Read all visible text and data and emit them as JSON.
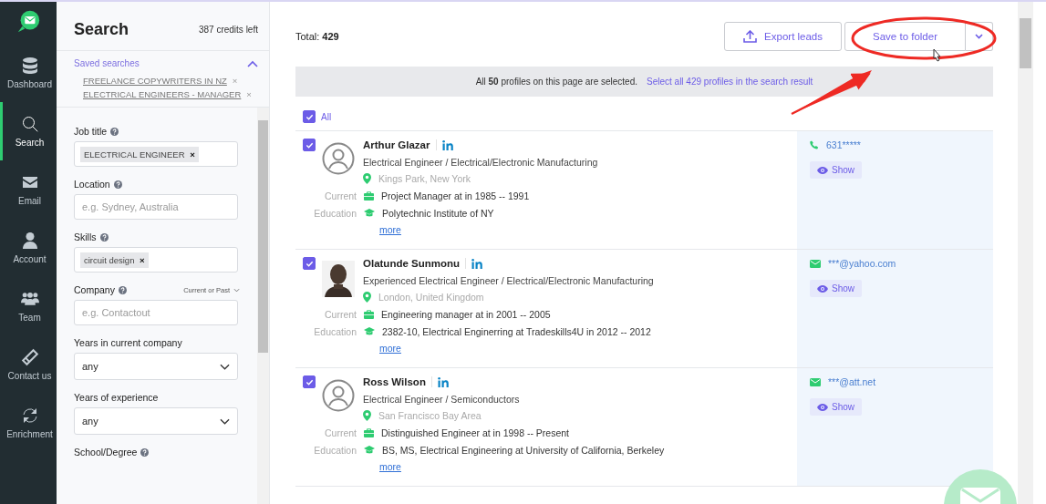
{
  "nav": {
    "items": [
      {
        "label": "Dashboard",
        "selected": false
      },
      {
        "label": "Search",
        "selected": true
      },
      {
        "label": "Email",
        "selected": false
      },
      {
        "label": "Account",
        "selected": false
      },
      {
        "label": "Team",
        "selected": false
      },
      {
        "label": "Contact us",
        "selected": false
      },
      {
        "label": "Enrichment",
        "selected": false
      }
    ]
  },
  "filters": {
    "title": "Search",
    "credits": "387 credits left",
    "saved_searches": {
      "label": "Saved searches",
      "expanded": true,
      "items": [
        {
          "label": "FREELANCE COPYWRITERS IN NZ",
          "remove": "×"
        },
        {
          "label": "ELECTRICAL ENGINEERS - MANAGER",
          "remove": "×"
        }
      ]
    },
    "fields": [
      {
        "kind": "tags",
        "label": "Job title",
        "help": true,
        "tags": [
          {
            "label": "ELECTRICAL ENGINEER",
            "remove": "×"
          }
        ]
      },
      {
        "kind": "text",
        "label": "Location",
        "help": true,
        "placeholder": "e.g. Sydney, Australia"
      },
      {
        "kind": "tags",
        "label": "Skills",
        "help": true,
        "tags": [
          {
            "label": "circuit design",
            "remove": "×"
          }
        ]
      },
      {
        "kind": "text",
        "label": "Company",
        "help": true,
        "option": "Current or Past",
        "placeholder": "e.g. Contactout"
      },
      {
        "kind": "select",
        "label": "Years in current company",
        "help": false,
        "value": "any"
      },
      {
        "kind": "select",
        "label": "Years of experience",
        "help": false,
        "value": "any"
      },
      {
        "kind": "cut",
        "label": "School/Degree",
        "help": true
      }
    ]
  },
  "results": {
    "total_label": "Total:",
    "total": "429",
    "export": "Export leads",
    "save": "Save to folder",
    "banner": {
      "text": "All **50** profiles on this page are selected.",
      "link": "Select all 429 profiles in the search result"
    },
    "select_all": {
      "label": "All",
      "checked": true
    },
    "profiles": [
      {
        "name": "Arthur Glazar",
        "checked": true,
        "avatar": {
          "kind": "placeholder"
        },
        "headline": "Electrical Engineer / Electrical/Electronic Manufacturing",
        "location": "Kings Park, New York",
        "current_label": "Current",
        "current": "Project Manager at in 1985 -- 1991",
        "education_label": "Education",
        "education": "Polytechnic Institute of NY",
        "more": "more",
        "contact": {
          "kind": "phone",
          "value": "631*****"
        },
        "show": "Show"
      },
      {
        "name": "Olatunde Sunmonu",
        "checked": true,
        "headline": "Experienced Electrical Engineer / Electrical/Electronic Manufacturing",
        "location": "London, United Kingdom",
        "current_label": "Current",
        "current": "Engineering manager at in 2001 -- 2005",
        "education_label": "Education",
        "education": "2382-10, Electrical Enginerring at Tradeskills4U in 2012 -- 2012",
        "more": "more",
        "contact": {
          "kind": "email",
          "value": "***@yahoo.com"
        },
        "show": "Show"
      },
      {
        "name": "Ross Wilson",
        "checked": true,
        "avatar": {
          "kind": "placeholder"
        },
        "headline": "Electrical Engineer / Semiconductors",
        "location": "San Francisco Bay Area",
        "current_label": "Current",
        "current": "Distinguished Engineer at in 1998 -- Present",
        "education_label": "Education",
        "education": "BS, MS, Electrical Engineering at University of California, Berkeley",
        "more": "more",
        "contact": {
          "kind": "email",
          "value": "***@att.net"
        },
        "show": "Show"
      }
    ]
  }
}
